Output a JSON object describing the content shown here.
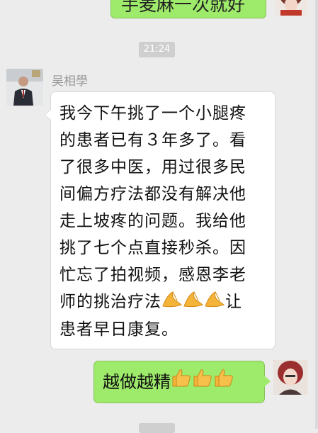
{
  "top_message": {
    "text": "手麦麻一次就好"
  },
  "timestamp": "21:24",
  "incoming": {
    "sender": "吴相學",
    "lines": [
      "我今下午挑了一个小腿疼",
      "的患者已有３年多了。看",
      "了很多中医，用过很多民",
      "间偏方疗法都没有解决他",
      "走上坡疼的问题。我给他",
      "挑了七个点直接秒杀。因",
      "忙忘了拍视频，感恩李老",
      "师的挑治疗法",
      "患者早日康复。"
    ],
    "after_emoji_text": "让"
  },
  "outgoing": {
    "text": "越做越精"
  },
  "emoji": {
    "praying": "folded-hands",
    "thumbs": "thumbs-up"
  }
}
